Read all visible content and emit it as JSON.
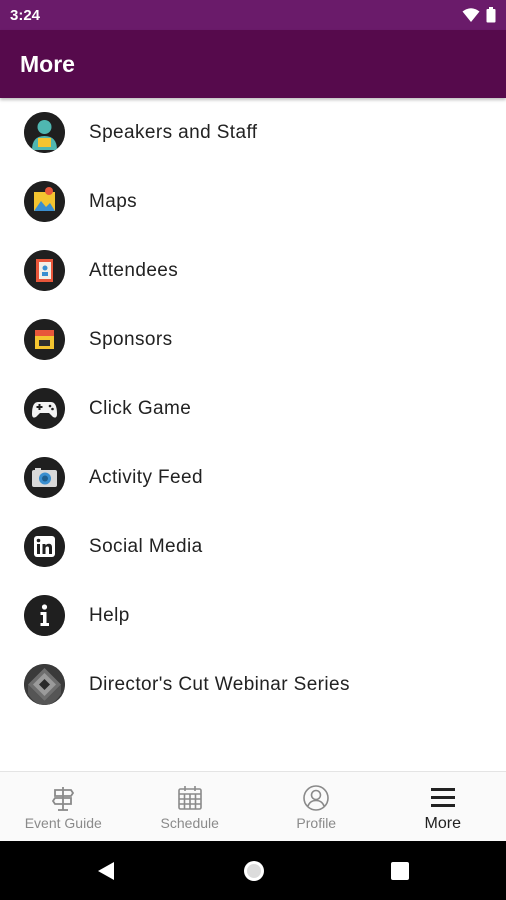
{
  "status_bar": {
    "time": "3:24",
    "wifi_icon": "wifi-icon",
    "battery_icon": "battery-icon"
  },
  "app_bar": {
    "title": "More"
  },
  "menu": {
    "items": [
      {
        "label": "Speakers and Staff",
        "icon": "person-speaker-icon"
      },
      {
        "label": "Maps",
        "icon": "map-pin-icon"
      },
      {
        "label": "Attendees",
        "icon": "address-book-icon"
      },
      {
        "label": "Sponsors",
        "icon": "sponsor-box-icon"
      },
      {
        "label": "Click Game",
        "icon": "gamepad-icon"
      },
      {
        "label": "Activity Feed",
        "icon": "camera-icon"
      },
      {
        "label": "Social Media",
        "icon": "linkedin-icon"
      },
      {
        "label": "Help",
        "icon": "info-icon"
      },
      {
        "label": "Director's Cut Webinar Series",
        "icon": "diamond-logo-icon"
      }
    ]
  },
  "bottom_nav": {
    "items": [
      {
        "label": "Event Guide",
        "icon": "signpost-icon",
        "active": false
      },
      {
        "label": "Schedule",
        "icon": "calendar-icon",
        "active": false
      },
      {
        "label": "Profile",
        "icon": "profile-icon",
        "active": false
      },
      {
        "label": "More",
        "icon": "hamburger-menu-icon",
        "active": true
      }
    ]
  },
  "colors": {
    "status_bar": "#6a1b6a",
    "app_bar": "#560a4c",
    "icon_bg": "#1f1f1f"
  }
}
